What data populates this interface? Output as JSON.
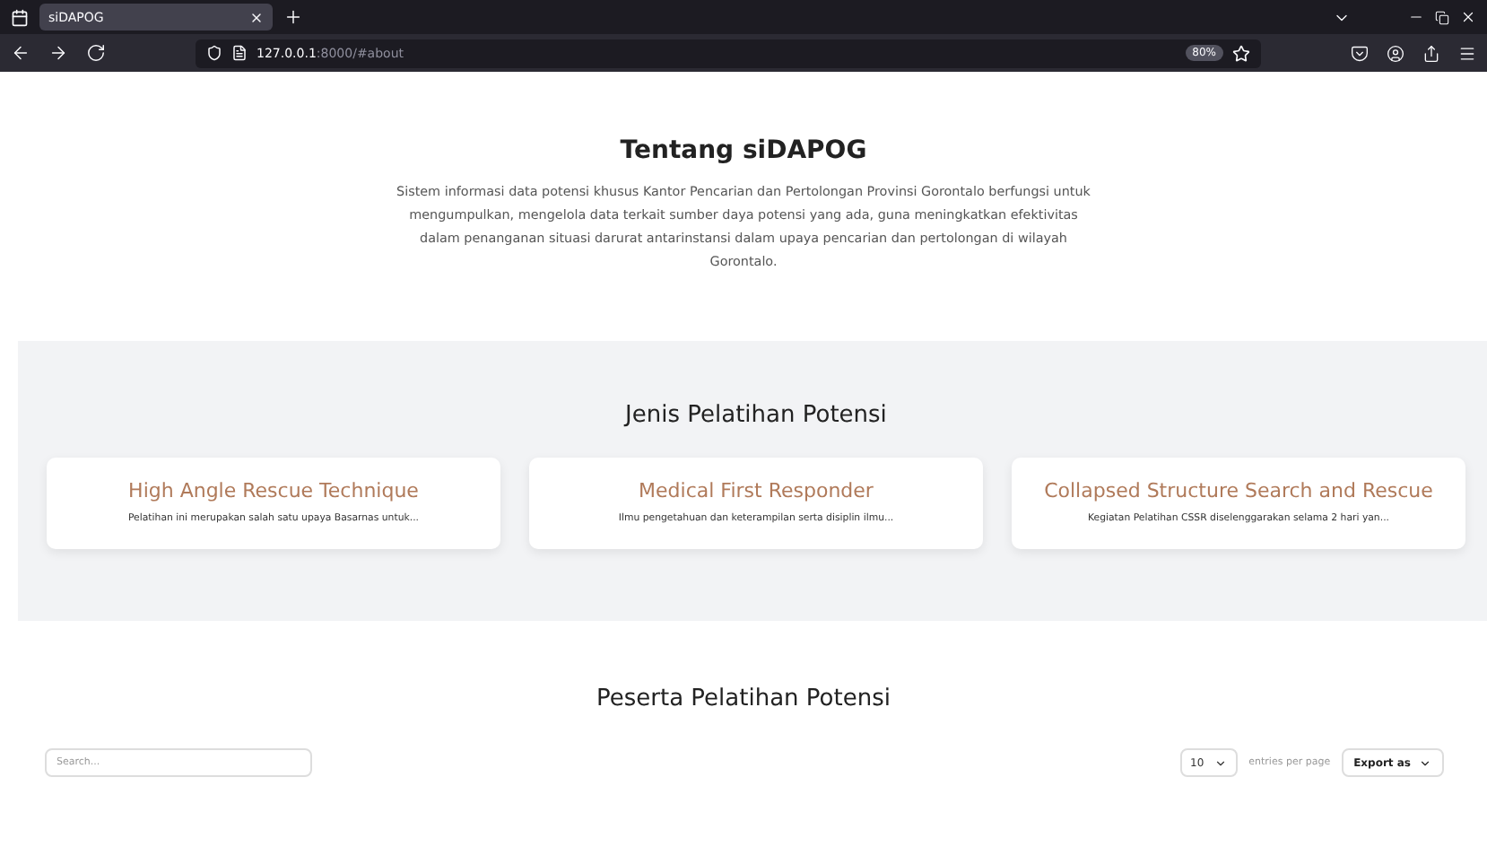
{
  "browser": {
    "tab_title": "siDAPOG",
    "url_host": "127.0.0.1",
    "url_rest": ":8000/#about",
    "zoom": "80%"
  },
  "about": {
    "title": "Tentang siDAPOG",
    "text": "Sistem informasi data potensi khusus Kantor Pencarian dan Pertolongan Provinsi Gorontalo berfungsi untuk mengumpulkan, mengelola data terkait sumber daya potensi yang ada, guna meningkatkan efektivitas dalam penanganan situasi darurat antarinstansi dalam upaya pencarian dan pertolongan di wilayah Gorontalo."
  },
  "trainings": {
    "title": "Jenis Pelatihan Potensi",
    "cards": [
      {
        "title": "High Angle Rescue Technique",
        "text": "Pelatihan ini merupakan salah satu upaya Basarnas untuk..."
      },
      {
        "title": "Medical First Responder",
        "text": "Ilmu pengetahuan dan keterampilan serta disiplin ilmu..."
      },
      {
        "title": "Collapsed Structure Search and Rescue",
        "text": "Kegiatan Pelatihan CSSR diselenggarakan selama 2 hari yan..."
      }
    ]
  },
  "participants": {
    "title": "Peserta Pelatihan Potensi",
    "search": {
      "placeholder": "Search..."
    },
    "per_page": "10",
    "per_page_label": "entries per page",
    "export": "Export as"
  }
}
